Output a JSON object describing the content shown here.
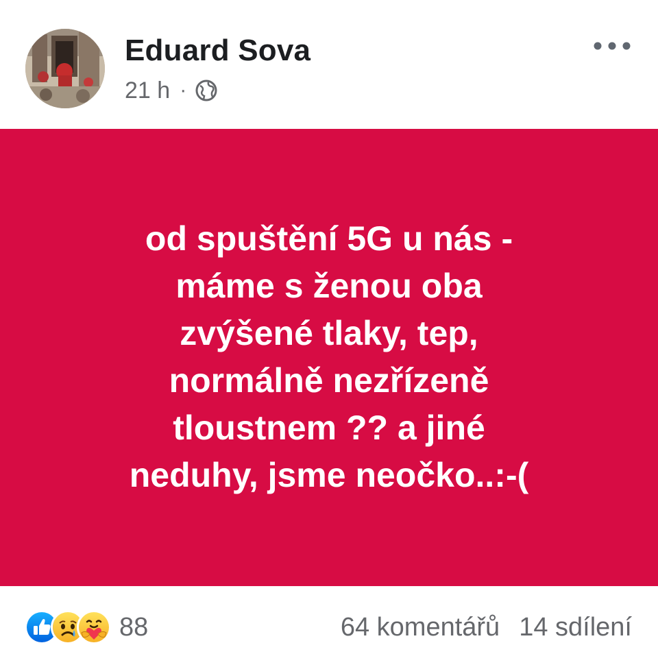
{
  "post": {
    "author": "Eduard Sova",
    "time": "21 h",
    "separator": "·",
    "audience_icon": "globe-icon",
    "more_icon": "more-horizontal-icon",
    "background_color": "#d70c44",
    "text_lines": [
      "od spuštění 5G u nás -",
      "máme s ženou oba",
      "zvýšené tlaky, tep,",
      "normálně nezřízeně",
      "tloustnem ?? a jiné",
      "neduhy, jsme neočko..:-("
    ]
  },
  "footer": {
    "reactions": [
      "like-icon",
      "sad-icon",
      "care-icon"
    ],
    "reaction_count": "88",
    "comments": "64 komentářů",
    "shares": "14 sdílení"
  }
}
